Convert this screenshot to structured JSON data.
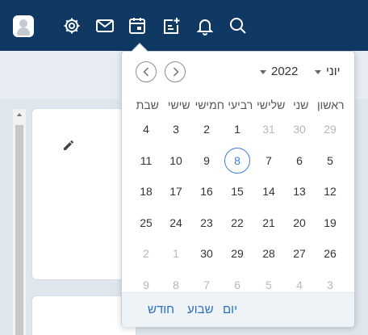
{
  "topbar": {
    "icons": [
      "avatar-icon",
      "gear-icon",
      "mail-icon",
      "calendar-icon",
      "add-task-icon",
      "bell-icon",
      "search-icon"
    ],
    "background_color": "#0f3863"
  },
  "calendar": {
    "month": "יוני",
    "year": "2022",
    "weekdays": [
      "ראשון",
      "שני",
      "שלישי",
      "רביעי",
      "חמישי",
      "שישי",
      "שבת"
    ],
    "weeks": [
      [
        {
          "d": "29",
          "o": true
        },
        {
          "d": "30",
          "o": true
        },
        {
          "d": "31",
          "o": true
        },
        {
          "d": "1"
        },
        {
          "d": "2"
        },
        {
          "d": "3"
        },
        {
          "d": "4"
        }
      ],
      [
        {
          "d": "5"
        },
        {
          "d": "6"
        },
        {
          "d": "7"
        },
        {
          "d": "8",
          "t": true
        },
        {
          "d": "9"
        },
        {
          "d": "10"
        },
        {
          "d": "11"
        }
      ],
      [
        {
          "d": "12"
        },
        {
          "d": "13"
        },
        {
          "d": "14"
        },
        {
          "d": "15"
        },
        {
          "d": "16"
        },
        {
          "d": "17"
        },
        {
          "d": "18"
        }
      ],
      [
        {
          "d": "19"
        },
        {
          "d": "20"
        },
        {
          "d": "21"
        },
        {
          "d": "22"
        },
        {
          "d": "23"
        },
        {
          "d": "24"
        },
        {
          "d": "25"
        }
      ],
      [
        {
          "d": "26"
        },
        {
          "d": "27"
        },
        {
          "d": "28"
        },
        {
          "d": "29"
        },
        {
          "d": "30"
        },
        {
          "d": "1",
          "o": true
        },
        {
          "d": "2",
          "o": true
        }
      ],
      [
        {
          "d": "3",
          "o": true
        },
        {
          "d": "4",
          "o": true
        },
        {
          "d": "5",
          "o": true
        },
        {
          "d": "6",
          "o": true
        },
        {
          "d": "7",
          "o": true
        },
        {
          "d": "8",
          "o": true
        },
        {
          "d": "9",
          "o": true
        }
      ]
    ],
    "footer": {
      "day_label": "יום",
      "week_label": "שבוע",
      "month_label": "חודש"
    },
    "accent_color": "#3b7fd4",
    "link_color": "#2f6fba"
  }
}
